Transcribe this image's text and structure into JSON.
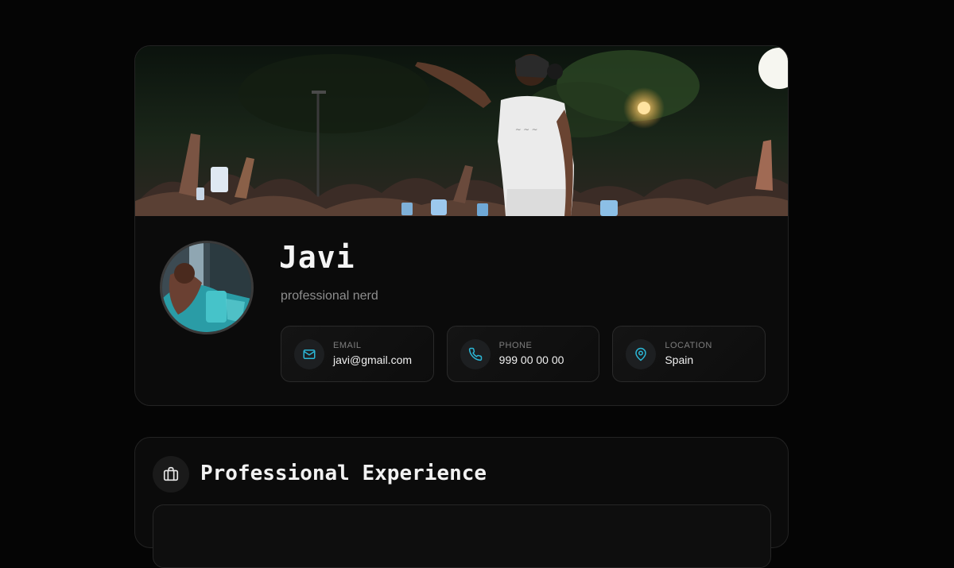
{
  "profile": {
    "name": "Javi",
    "tagline": "professional nerd",
    "contacts": [
      {
        "label": "EMAIL",
        "value": "javi@gmail.com",
        "icon": "mail-icon"
      },
      {
        "label": "PHONE",
        "value": "999 00 00 00",
        "icon": "phone-icon"
      },
      {
        "label": "LOCATION",
        "value": "Spain",
        "icon": "map-pin-icon"
      }
    ]
  },
  "experience": {
    "title": "Professional Experience",
    "icon": "briefcase-icon"
  },
  "colors": {
    "background": "#050505",
    "card": "#0b0b0b",
    "accent": "#2bb7d6",
    "muted_text": "#8e8e8e"
  }
}
